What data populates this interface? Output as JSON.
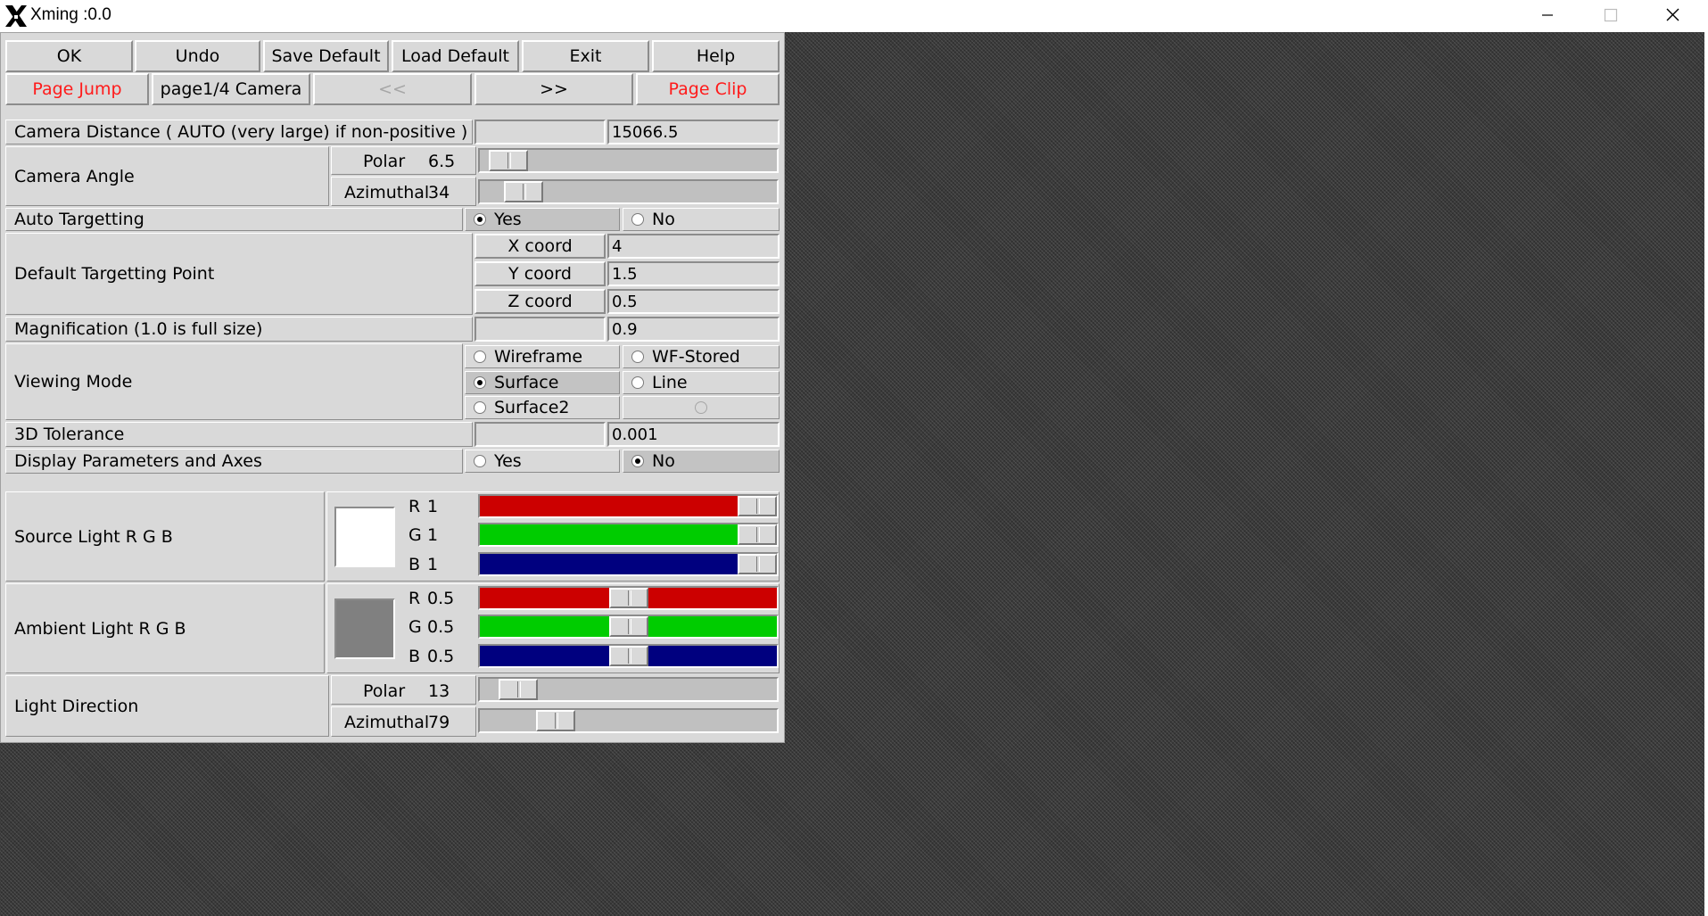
{
  "window": {
    "title": "Xming :0.0"
  },
  "toolbar": {
    "row1": [
      "OK",
      "Undo",
      "Save Default",
      "Load Default",
      "Exit",
      "Help"
    ],
    "page_jump": "Page Jump",
    "page_label": "page1/4 Camera",
    "prev": "<<",
    "next": ">>",
    "page_clip": "Page Clip"
  },
  "camera_distance": {
    "label": "Camera Distance ( AUTO (very large) if non-positive )",
    "value": "15066.5"
  },
  "camera_angle": {
    "label": "Camera Angle",
    "polar": {
      "label": "Polar",
      "value": "6.5",
      "fraction": 0.036
    },
    "azimuthal": {
      "label": "Azimuthal",
      "value": "34",
      "fraction": 0.094
    }
  },
  "auto_targetting": {
    "label": "Auto Targetting",
    "options": [
      "Yes",
      "No"
    ],
    "selected": "Yes"
  },
  "targetting_point": {
    "label": "Default Targetting Point",
    "x": {
      "label": "X coord",
      "value": "4"
    },
    "y": {
      "label": "Y coord",
      "value": "1.5"
    },
    "z": {
      "label": "Z coord",
      "value": "0.5"
    }
  },
  "magnification": {
    "label": "Magnification (1.0 is full size)",
    "value": "0.9"
  },
  "viewing_mode": {
    "label": "Viewing Mode",
    "options": [
      "Wireframe",
      "WF-Stored",
      "Surface",
      "Line",
      "Surface2"
    ],
    "selected": "Surface"
  },
  "tolerance": {
    "label": "3D Tolerance",
    "value": "0.001"
  },
  "display_params": {
    "label": "Display Parameters and Axes",
    "options": [
      "Yes",
      "No"
    ],
    "selected": "No"
  },
  "source_light": {
    "label": "Source  Light  R G B",
    "swatch_color": "#ffffff",
    "r": {
      "label": "R",
      "value": "1",
      "fraction": 1.0
    },
    "g": {
      "label": "G",
      "value": "1",
      "fraction": 1.0
    },
    "b": {
      "label": "B",
      "value": "1",
      "fraction": 1.0
    }
  },
  "ambient_light": {
    "label": "Ambient Light  R G B",
    "swatch_color": "#808080",
    "r": {
      "label": "R",
      "value": "0.5",
      "fraction": 0.5
    },
    "g": {
      "label": "G",
      "value": "0.5",
      "fraction": 0.5
    },
    "b": {
      "label": "B",
      "value": "0.5",
      "fraction": 0.5
    }
  },
  "light_direction": {
    "label": "Light Direction",
    "polar": {
      "label": "Polar",
      "value": "13",
      "fraction": 0.072
    },
    "azimuthal": {
      "label": "Azimuthal",
      "value": "79",
      "fraction": 0.219
    }
  },
  "colors": {
    "red": "#cc0000",
    "green": "#00cc00",
    "blue": "#00007f",
    "accent": "#ff1a1a"
  }
}
